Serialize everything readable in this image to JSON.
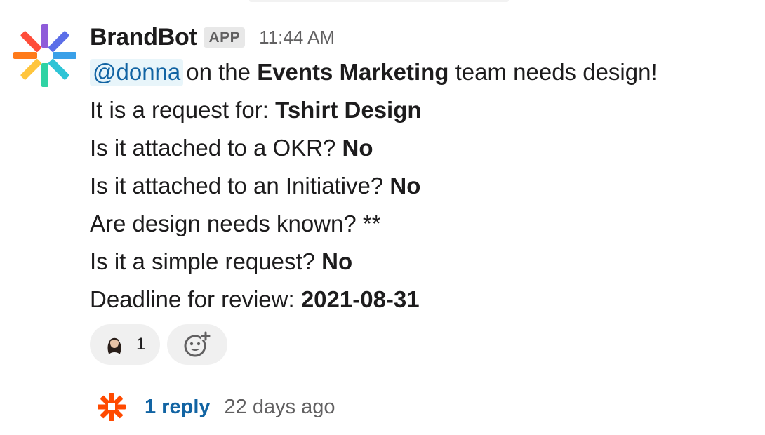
{
  "message": {
    "sender": "BrandBot",
    "badge": "APP",
    "timestamp": "11:44 AM",
    "mention": "@donna",
    "line1": {
      "pre": "on the ",
      "team": "Events Marketing",
      "post": " team needs design!"
    },
    "fields": [
      {
        "label": "It is a request for: ",
        "value": "Tshirt Design"
      },
      {
        "label": "Is it attached to a OKR? ",
        "value": "No"
      },
      {
        "label": "Is it attached to an Initiative? ",
        "value": "No"
      },
      {
        "label": "Are design needs known? **",
        "value": ""
      },
      {
        "label": "Is it a simple request? ",
        "value": "No"
      },
      {
        "label": "Deadline for review: ",
        "value": "2021-08-31"
      }
    ]
  },
  "reactions": {
    "user_reaction_count": "1",
    "add_reaction_icon": "add-emoji-icon"
  },
  "thread": {
    "reply_label": "1 reply",
    "reply_time": "22 days ago"
  },
  "colors": {
    "link": "#1264a3",
    "mention_bg": "#e8f5fa",
    "muted": "#616061",
    "text": "#1d1c1d",
    "pill_bg": "#f0f0f0"
  }
}
